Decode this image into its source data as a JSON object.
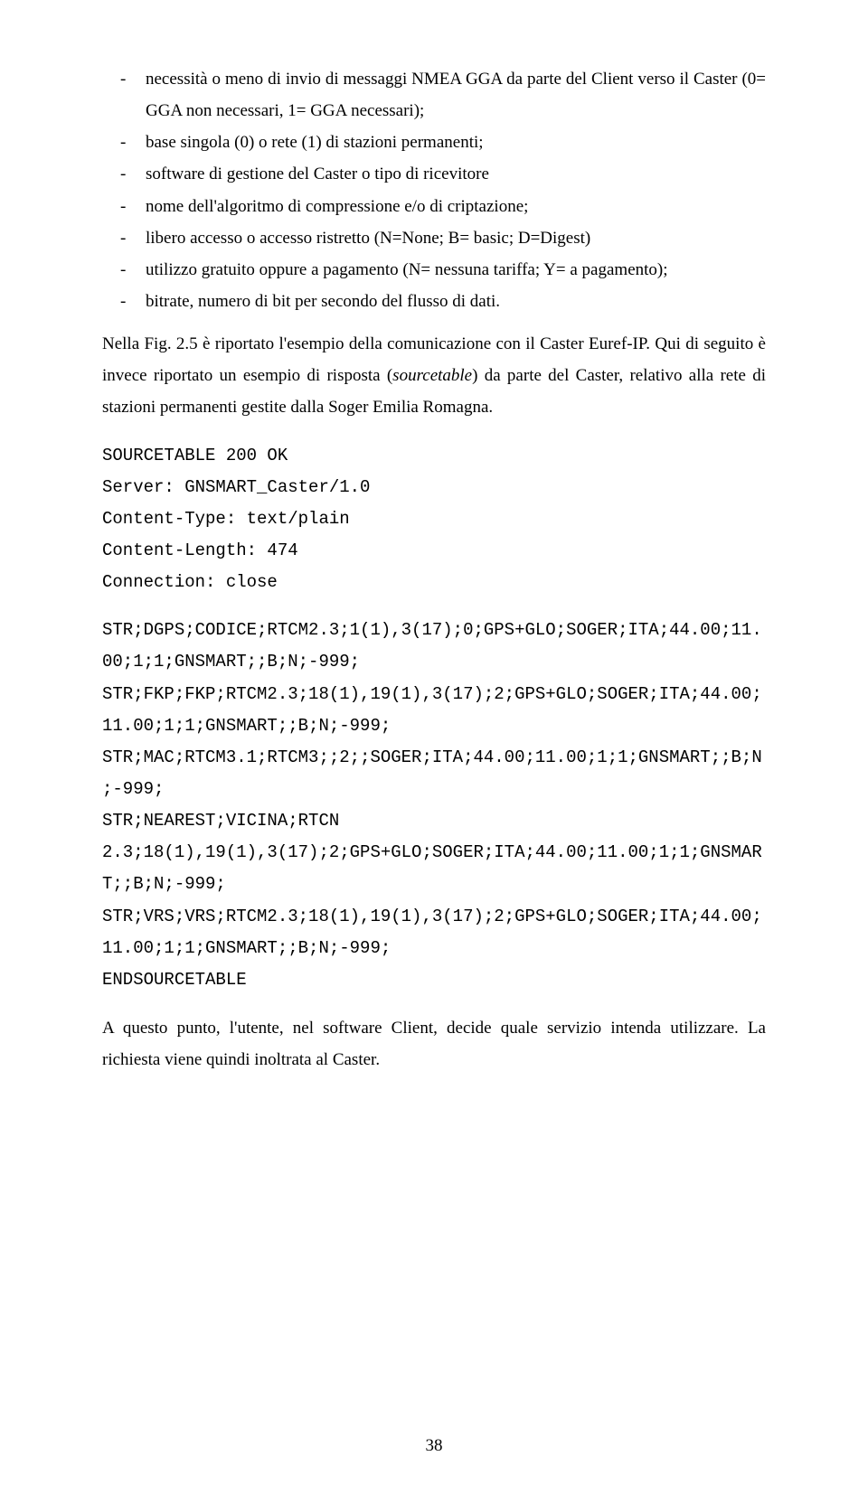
{
  "bullets": [
    "necessità o meno di invio di messaggi NMEA GGA da parte del Client verso il Caster (0= GGA non necessari, 1= GGA necessari);",
    "base singola (0) o rete (1) di stazioni permanenti;",
    "software di gestione del Caster o tipo di ricevitore",
    "nome dell'algoritmo di compressione e/o di criptazione;",
    "libero accesso o accesso ristretto (N=None; B= basic; D=Digest)",
    "utilizzo gratuito oppure a pagamento (N= nessuna tariffa; Y= a pagamento);",
    "bitrate, numero di bit per secondo del flusso di dati."
  ],
  "para1_a": "Nella Fig. 2.5 è riportato l'esempio della comunicazione con il Caster Euref-IP. Qui di seguito è invece riportato un esempio di risposta (",
  "para1_i": "sourcetable",
  "para1_b": ") da parte del Caster, relativo alla rete di stazioni permanenti gestite dalla Soger Emilia Romagna.",
  "mono1": [
    "SOURCETABLE 200 OK",
    "Server: GNSMART_Caster/1.0",
    "Content-Type: text/plain",
    "Content-Length: 474",
    "Connection: close"
  ],
  "mono2": [
    "STR;DGPS;CODICE;RTCM2.3;1(1),3(17);0;GPS+GLO;SOGER;ITA;44.00;11.00;1;1;GNSMART;;B;N;-999;",
    "STR;FKP;FKP;RTCM2.3;18(1),19(1),3(17);2;GPS+GLO;SOGER;ITA;44.00;11.00;1;1;GNSMART;;B;N;-999;",
    "STR;MAC;RTCM3.1;RTCM3;;2;;SOGER;ITA;44.00;11.00;1;1;GNSMART;;B;N;-999;",
    "STR;NEAREST;VICINA;RTCN 2.3;18(1),19(1),3(17);2;GPS+GLO;SOGER;ITA;44.00;11.00;1;1;GNSMART;;B;N;-999;",
    "STR;VRS;VRS;RTCM2.3;18(1),19(1),3(17);2;GPS+GLO;SOGER;ITA;44.00;11.00;1;1;GNSMART;;B;N;-999;",
    "ENDSOURCETABLE"
  ],
  "para2": "A questo punto, l'utente, nel software Client, decide quale servizio intenda utilizzare. La richiesta viene quindi inoltrata al Caster.",
  "page_number": "38"
}
